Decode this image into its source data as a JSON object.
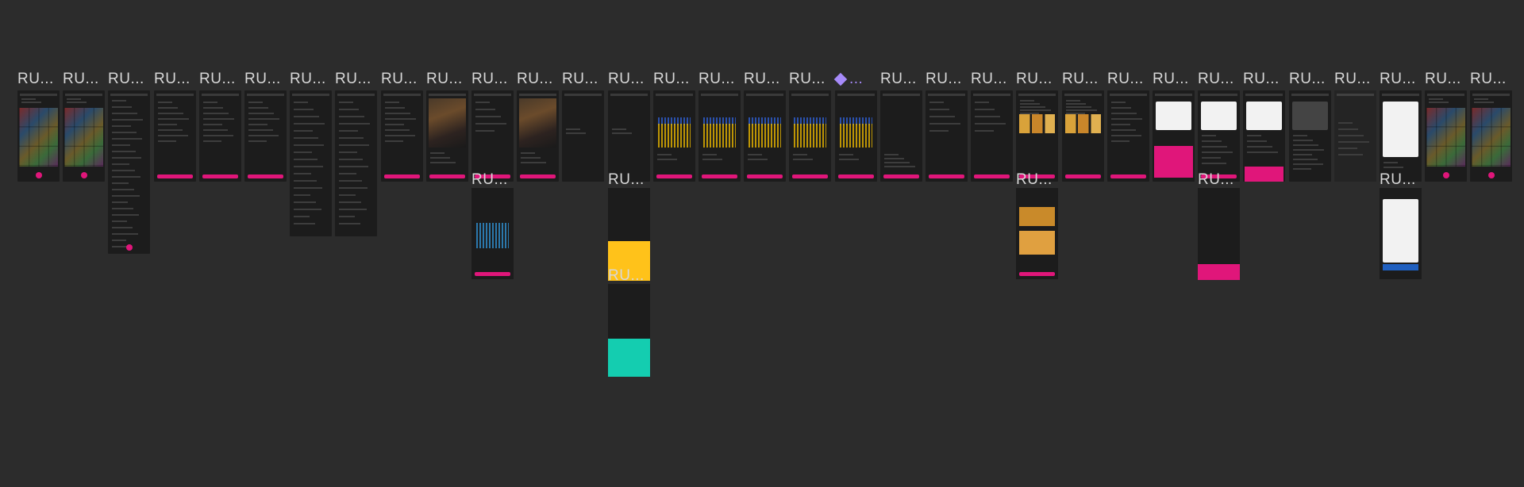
{
  "canvas": {
    "background": "#2c2c2c",
    "accent": "#e0167a"
  },
  "frames": [
    {
      "label": "RU...",
      "kind": "grid"
    },
    {
      "label": "RU...",
      "kind": "grid"
    },
    {
      "label": "RU...",
      "kind": "list-long"
    },
    {
      "label": "RU...",
      "kind": "form"
    },
    {
      "label": "RU...",
      "kind": "form"
    },
    {
      "label": "RU...",
      "kind": "form"
    },
    {
      "label": "RU...",
      "kind": "form-mid"
    },
    {
      "label": "RU...",
      "kind": "form-mid"
    },
    {
      "label": "RU...",
      "kind": "form"
    },
    {
      "label": "RU...",
      "kind": "poster"
    },
    {
      "label": "RU...",
      "kind": "plain"
    },
    {
      "label": "RU...",
      "kind": "poster"
    },
    {
      "label": "RU...",
      "kind": "empty"
    },
    {
      "label": "RU...",
      "kind": "empty"
    },
    {
      "label": "RU...",
      "kind": "seats"
    },
    {
      "label": "RU...",
      "kind": "seats"
    },
    {
      "label": "RU...",
      "kind": "seats"
    },
    {
      "label": "RU...",
      "kind": "seats"
    },
    {
      "label": "...",
      "kind": "seats-component",
      "icon": "component-icon"
    },
    {
      "label": "RU...",
      "kind": "dialog"
    },
    {
      "label": "RU...",
      "kind": "plain"
    },
    {
      "label": "RU...",
      "kind": "plain"
    },
    {
      "label": "RU...",
      "kind": "food"
    },
    {
      "label": "RU...",
      "kind": "food"
    },
    {
      "label": "RU...",
      "kind": "form"
    },
    {
      "label": "RU...",
      "kind": "pink"
    },
    {
      "label": "RU...",
      "kind": "white"
    },
    {
      "label": "RU...",
      "kind": "white-pink"
    },
    {
      "label": "RU...",
      "kind": "white-dark"
    },
    {
      "label": "RU...",
      "kind": "blur"
    },
    {
      "label": "RU...",
      "kind": "ticket"
    },
    {
      "label": "RU...",
      "kind": "grid"
    },
    {
      "label": "RU...",
      "kind": "grid"
    }
  ],
  "subframes": [
    {
      "label": "RU...",
      "kind": "seats-blur"
    },
    {
      "label": "RU...",
      "kind": "yellow"
    },
    {
      "label": "RU...",
      "kind": "teal"
    },
    {
      "label": "RU...",
      "kind": "food-list"
    },
    {
      "label": "RU...",
      "kind": "pink-bottom"
    },
    {
      "label": "RU...",
      "kind": "ticket-long"
    }
  ]
}
